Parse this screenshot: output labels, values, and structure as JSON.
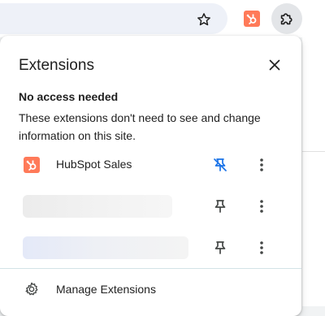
{
  "popup": {
    "title": "Extensions",
    "section_heading": "No access needed",
    "section_description": "These extensions don't need to see and change information on this site.",
    "manage_label": "Manage Extensions"
  },
  "extensions": [
    {
      "name": "HubSpot Sales",
      "icon": "hubspot-icon",
      "pinned": true
    },
    {
      "name": "",
      "icon": "blurred",
      "pinned": false
    },
    {
      "name": "",
      "icon": "blurred",
      "pinned": false
    }
  ],
  "icons": {
    "toolbar_star": "star-icon",
    "toolbar_hubspot": "hubspot-icon",
    "toolbar_extensions": "puzzle-icon",
    "close": "close-icon",
    "pin": "pin-icon",
    "unpin": "unpin-icon",
    "more": "more-vert-icon",
    "manage": "gear-icon"
  },
  "colors": {
    "hubspot_orange": "#ff7a59",
    "accent_blue": "#1a73e8",
    "icon_gray": "#444746"
  }
}
